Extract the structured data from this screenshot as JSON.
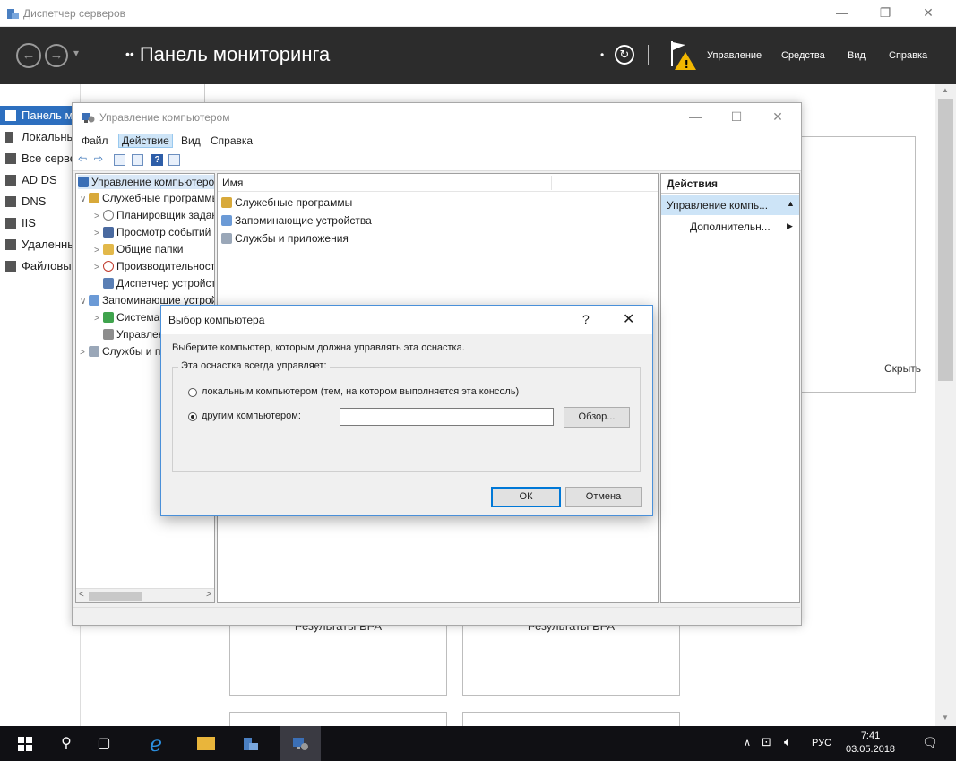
{
  "server_manager": {
    "title": "Диспетчер серверов",
    "breadcrumb_arrow": "••",
    "breadcrumb": "Панель мониторинга",
    "menu": [
      "Управление",
      "Средства",
      "Вид",
      "Справка"
    ],
    "nav": [
      {
        "label": "Панель мониторинга",
        "selected": true
      },
      {
        "label": "Локальный сервер"
      },
      {
        "label": "Все серверы"
      },
      {
        "label": "AD DS"
      },
      {
        "label": "DNS"
      },
      {
        "label": "IIS"
      },
      {
        "label": "Удаленный доступ"
      },
      {
        "label": "Файловые службы"
      }
    ],
    "hide_label": "Скрыть",
    "bpa_results": [
      "Результаты BPA",
      "Результаты BPA"
    ],
    "colors": {
      "header_bg": "#2c2c2c",
      "nav_selected": "#2d6fbf",
      "flag_warning": "#f2b701"
    }
  },
  "computer_management": {
    "title": "Управление компьютером",
    "menu": [
      "Файл",
      "Действие",
      "Вид",
      "Справка"
    ],
    "active_menu": "Действие",
    "tree": [
      {
        "label": "Управление компьютером (локальным)",
        "level": 0,
        "expander": "",
        "icon": "computer-mgmt-icon",
        "selected": true
      },
      {
        "label": "Служебные программы",
        "level": 1,
        "expander": "∨",
        "icon": "tools-icon"
      },
      {
        "label": "Планировщик заданий",
        "level": 2,
        "expander": ">",
        "icon": "clock-icon"
      },
      {
        "label": "Просмотр событий",
        "level": 2,
        "expander": ">",
        "icon": "event-viewer-icon"
      },
      {
        "label": "Общие папки",
        "level": 2,
        "expander": ">",
        "icon": "shared-folder-icon"
      },
      {
        "label": "Производительность",
        "level": 2,
        "expander": ">",
        "icon": "performance-icon"
      },
      {
        "label": "Диспетчер устройств",
        "level": 2,
        "expander": "",
        "icon": "device-manager-icon"
      },
      {
        "label": "Запоминающие устройства",
        "level": 1,
        "expander": "∨",
        "icon": "storage-icon"
      },
      {
        "label": "Система архивации",
        "level": 2,
        "expander": ">",
        "icon": "backup-icon"
      },
      {
        "label": "Управление дисками",
        "level": 2,
        "expander": "",
        "icon": "disk-mgmt-icon"
      },
      {
        "label": "Службы и приложения",
        "level": 1,
        "expander": ">",
        "icon": "services-icon"
      }
    ],
    "list_header": "Имя",
    "list_items": [
      "Служебные программы",
      "Запоминающие устройства",
      "Службы и приложения"
    ],
    "actions_header": "Действия",
    "actions_selected": "Управление компь...",
    "actions_sub": "Дополнительн...",
    "scroll_left": "<",
    "scroll_right": ">"
  },
  "dialog": {
    "title": "Выбор компьютера",
    "help": "?",
    "close": "✕",
    "instruction": "Выберите компьютер, которым должна управлять эта оснастка.",
    "group_label": "Эта оснастка всегда управляет:",
    "option_local": "локальным компьютером (тем, на котором выполняется эта консоль)",
    "option_other": "другим компьютером:",
    "selected_option": "other",
    "computer_name_value": "",
    "browse": "Обзор...",
    "ok": "ОК",
    "cancel": "Отмена"
  },
  "taskbar": {
    "language": "РУС",
    "time": "7:41",
    "date": "03.05.2018"
  }
}
